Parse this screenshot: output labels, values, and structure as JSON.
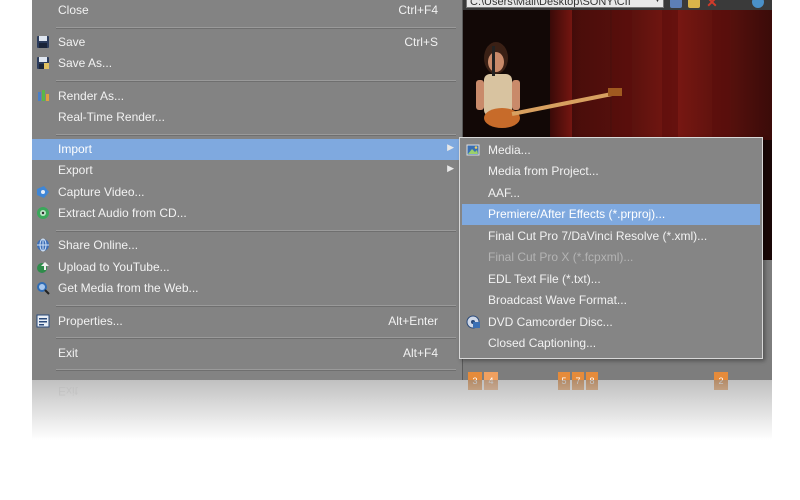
{
  "path_bar": {
    "text": "C:\\Users\\Mail\\Desktop\\SONY\\CII",
    "dropdown_icon": "chevron-down-icon"
  },
  "file_menu": {
    "items": [
      {
        "label": "Close",
        "shortcut": "Ctrl+F4"
      },
      {
        "label": "Save",
        "shortcut": "Ctrl+S",
        "icon": "save-icon"
      },
      {
        "label": "Save As...",
        "shortcut": "",
        "icon": "save-as-icon"
      },
      {
        "label": "Render As...",
        "shortcut": "",
        "icon": "render-icon"
      },
      {
        "label": "Real-Time Render...",
        "shortcut": ""
      },
      {
        "label": "Import",
        "shortcut": "",
        "has_submenu": true
      },
      {
        "label": "Export",
        "shortcut": "",
        "has_submenu": true
      },
      {
        "label": "Capture Video...",
        "shortcut": "",
        "icon": "capture-video-icon"
      },
      {
        "label": "Extract Audio from CD...",
        "shortcut": "",
        "icon": "cd-icon"
      },
      {
        "label": "Share Online...",
        "shortcut": "",
        "icon": "globe-icon"
      },
      {
        "label": "Upload to YouTube...",
        "shortcut": "",
        "icon": "upload-icon"
      },
      {
        "label": "Get Media from the Web...",
        "shortcut": "",
        "icon": "web-search-icon"
      },
      {
        "label": "Properties...",
        "shortcut": "Alt+Enter",
        "icon": "properties-icon"
      },
      {
        "label": "Exit",
        "shortcut": "Alt+F4"
      }
    ]
  },
  "import_submenu": {
    "items": [
      {
        "label": "Media...",
        "icon": "media-icon"
      },
      {
        "label": "Media from Project..."
      },
      {
        "label": "AAF..."
      },
      {
        "label": "Premiere/After Effects (*.prproj)...",
        "highlighted": true
      },
      {
        "label": "Final Cut Pro 7/DaVinci Resolve (*.xml)..."
      },
      {
        "label": "Final Cut Pro X (*.fcpxml)...",
        "disabled": true
      },
      {
        "label": "EDL Text File (*.txt)..."
      },
      {
        "label": "Broadcast Wave Format..."
      },
      {
        "label": "DVD Camcorder Disc...",
        "icon": "dvd-icon"
      },
      {
        "label": "Closed Captioning..."
      }
    ]
  },
  "timeline_markers": [
    "3",
    "4",
    "5",
    "7",
    "8",
    "2"
  ],
  "colors": {
    "menu_bg": "#838383",
    "highlight": "#7fa9df",
    "menu_text": "#f2f2f2",
    "disabled_text": "#b4b4b4",
    "marker": "#e58b3b"
  }
}
